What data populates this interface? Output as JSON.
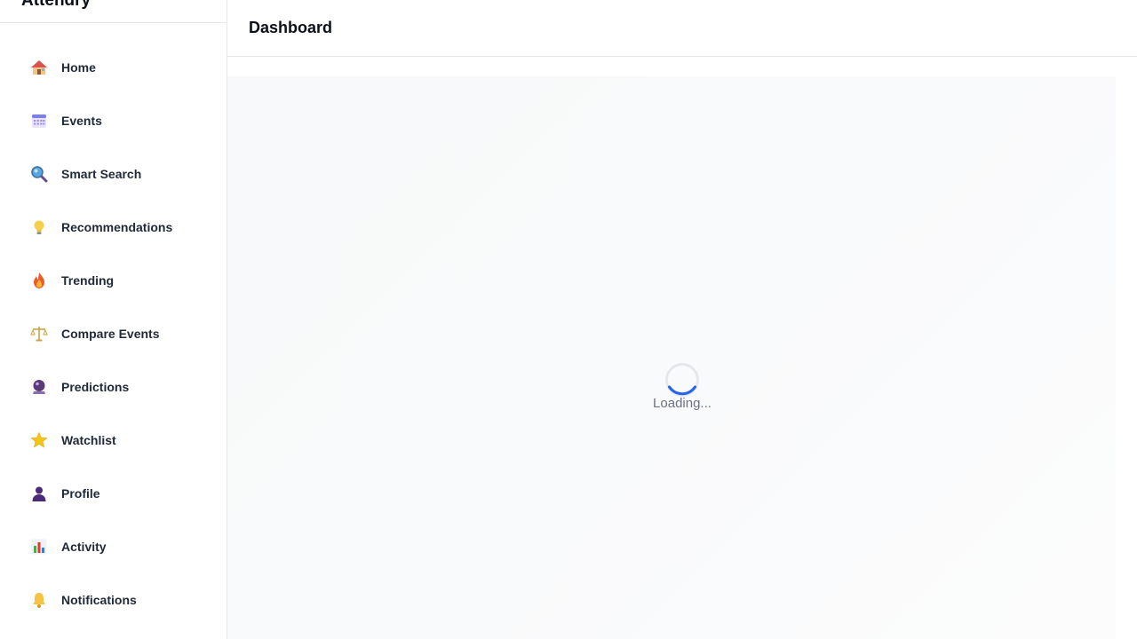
{
  "app": {
    "name": "Attendry"
  },
  "header": {
    "title": "Dashboard"
  },
  "sidebar": {
    "items": [
      {
        "label": "Home",
        "icon": "house-icon"
      },
      {
        "label": "Events",
        "icon": "calendar-icon"
      },
      {
        "label": "Smart Search",
        "icon": "magnifier-icon"
      },
      {
        "label": "Recommendations",
        "icon": "lightbulb-icon"
      },
      {
        "label": "Trending",
        "icon": "fire-icon"
      },
      {
        "label": "Compare Events",
        "icon": "scales-icon"
      },
      {
        "label": "Predictions",
        "icon": "crystal-ball-icon"
      },
      {
        "label": "Watchlist",
        "icon": "star-icon"
      },
      {
        "label": "Profile",
        "icon": "person-silhouette-icon"
      },
      {
        "label": "Activity",
        "icon": "bar-chart-icon"
      },
      {
        "label": "Notifications",
        "icon": "bell-icon"
      }
    ]
  },
  "main": {
    "loading_text": "Loading..."
  },
  "colors": {
    "accent": "#2563eb",
    "border": "#e5e7eb",
    "muted_text": "#6b7280",
    "panel_bg": "#f9fafb"
  }
}
